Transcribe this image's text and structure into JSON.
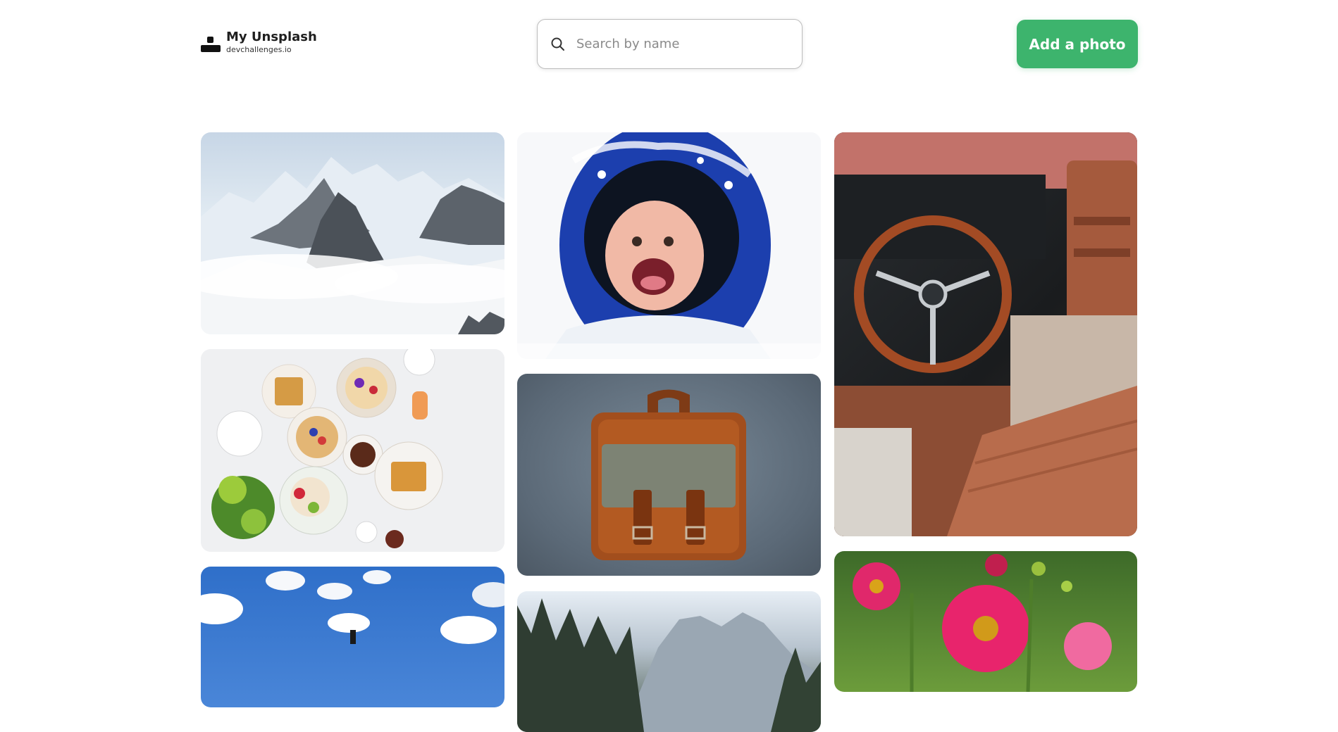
{
  "brand": {
    "title": "My Unsplash",
    "subtitle": "devchallenges.io",
    "logo_icon": "unsplash-logo-icon"
  },
  "search": {
    "placeholder": "Search by name",
    "value": "",
    "icon": "search-icon"
  },
  "actions": {
    "add_photo_label": "Add a photo"
  },
  "colors": {
    "accent": "#3db46d",
    "text_dark": "#1f1f1f",
    "placeholder": "#8a8a8a",
    "border": "#bdbdbd"
  },
  "gallery": {
    "photos": [
      {
        "subject": "mountains",
        "alt": "mountains"
      },
      {
        "subject": "child-in-snow",
        "alt": "child in snow"
      },
      {
        "subject": "car-interior",
        "alt": "car interior"
      },
      {
        "subject": "breakfast-food",
        "alt": "breakfast food"
      },
      {
        "subject": "leather-bag",
        "alt": "leather bag"
      },
      {
        "subject": "blue-sky",
        "alt": "blue sky"
      },
      {
        "subject": "mountain-forest",
        "alt": "mountain forest"
      },
      {
        "subject": "pink-flowers",
        "alt": "pink flowers"
      }
    ]
  }
}
